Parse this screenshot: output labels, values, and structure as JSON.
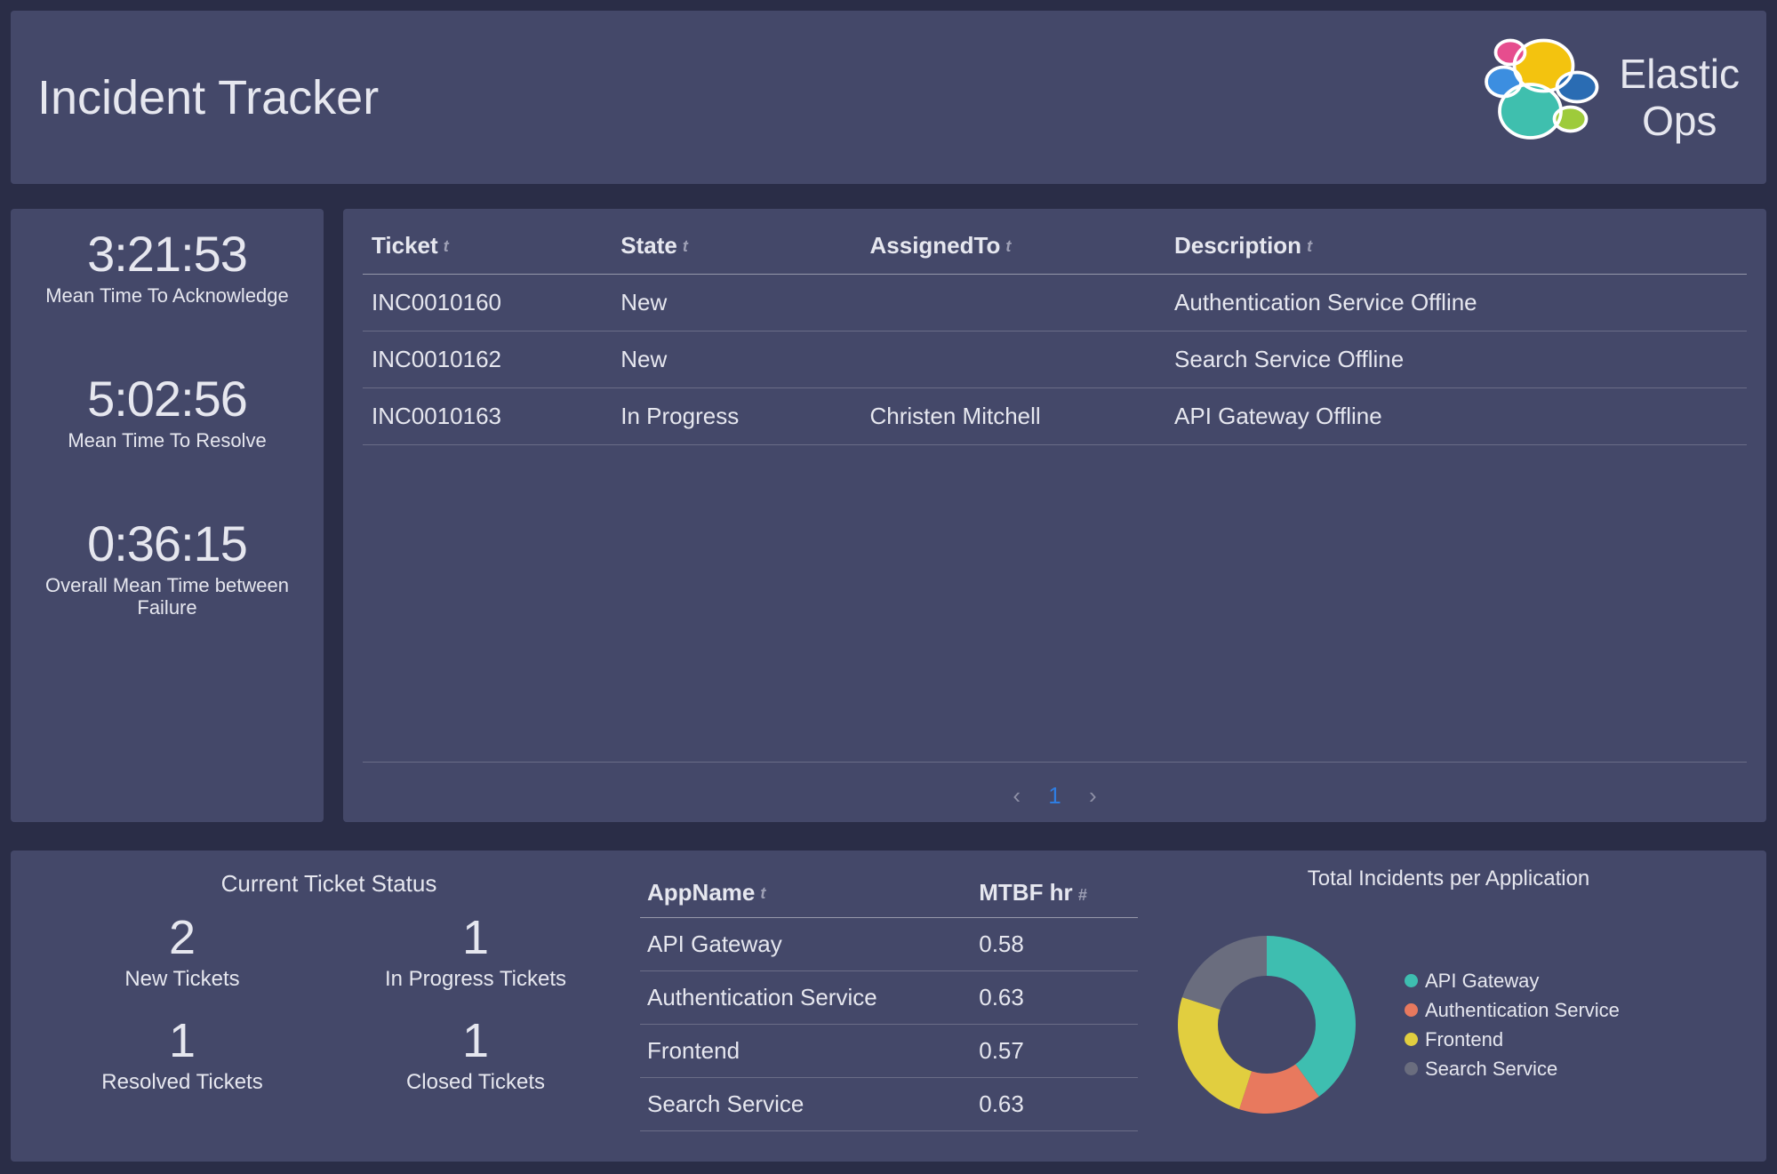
{
  "header": {
    "title": "Incident Tracker",
    "brand_line1": "Elastic",
    "brand_line2": "Ops"
  },
  "metrics": {
    "mtta_value": "3:21:53",
    "mtta_label": "Mean Time To Acknowledge",
    "mttr_value": "5:02:56",
    "mttr_label": "Mean Time To Resolve",
    "mtbf_value": "0:36:15",
    "mtbf_label_l1": "Overall Mean Time between",
    "mtbf_label_l2": "Failure"
  },
  "ticket_table": {
    "headers": {
      "ticket": "Ticket",
      "state": "State",
      "assigned": "AssignedTo",
      "desc": "Description"
    },
    "rows": [
      {
        "ticket": "INC0010160",
        "state": "New",
        "assigned": "",
        "desc": "Authentication Service Offline"
      },
      {
        "ticket": "INC0010162",
        "state": "New",
        "assigned": "",
        "desc": "Search Service Offline"
      },
      {
        "ticket": "INC0010163",
        "state": "In Progress",
        "assigned": "Christen Mitchell",
        "desc": "API Gateway Offline"
      }
    ],
    "pager_page": "1"
  },
  "status": {
    "title": "Current Ticket Status",
    "items": [
      {
        "num": "2",
        "label": "New Tickets"
      },
      {
        "num": "1",
        "label": "In Progress Tickets"
      },
      {
        "num": "1",
        "label": "Resolved Tickets"
      },
      {
        "num": "1",
        "label": "Closed Tickets"
      }
    ]
  },
  "mtbf_table": {
    "headers": {
      "app": "AppName",
      "mtbf": "MTBF hr"
    },
    "rows": [
      {
        "app": "API Gateway",
        "mtbf": "0.58"
      },
      {
        "app": "Authentication Service",
        "mtbf": "0.63"
      },
      {
        "app": "Frontend",
        "mtbf": "0.57"
      },
      {
        "app": "Search Service",
        "mtbf": "0.63"
      }
    ]
  },
  "donut": {
    "title": "Total Incidents per Application",
    "legend": [
      {
        "label": "API Gateway",
        "color": "#3ebeb0"
      },
      {
        "label": "Authentication Service",
        "color": "#e8795e"
      },
      {
        "label": "Frontend",
        "color": "#e1ce3f"
      },
      {
        "label": "Search Service",
        "color": "#6a6d7e"
      }
    ]
  },
  "colors": {
    "teal": "#3ebeb0",
    "orange": "#e8795e",
    "yellow": "#e1ce3f",
    "gray": "#6a6d7e"
  },
  "chart_data": {
    "type": "pie",
    "title": "Total Incidents per Application",
    "categories": [
      "API Gateway",
      "Authentication Service",
      "Frontend",
      "Search Service"
    ],
    "values": [
      40,
      15,
      25,
      20
    ],
    "colors": [
      "#3ebeb0",
      "#e8795e",
      "#e1ce3f",
      "#6a6d7e"
    ]
  }
}
